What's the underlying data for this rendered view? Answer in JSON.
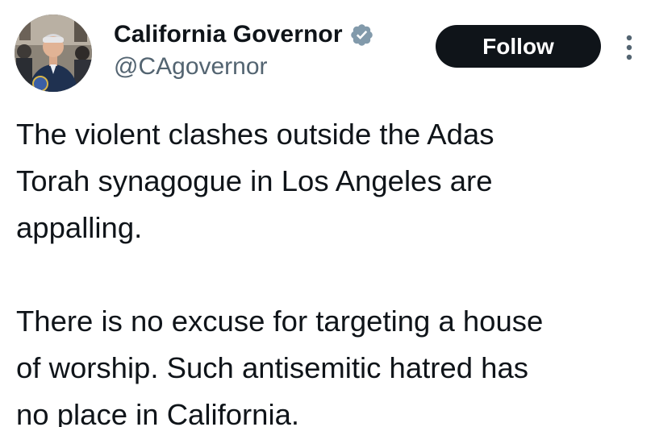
{
  "author": {
    "display_name": "California Governor",
    "handle": "@CAgovernor",
    "verified_icon": "verified-badge-icon",
    "verified_color": "#829aab",
    "avatar_icon": "profile-photo-avatar"
  },
  "actions": {
    "follow_label": "Follow",
    "more_icon": "more-options-icon"
  },
  "tweet": {
    "paragraph1_lines": [
      "The violent clashes outside the Adas",
      "Torah synagogue in Los Angeles are",
      "appalling."
    ],
    "paragraph2_lines": [
      "There is no excuse for targeting a house",
      "of worship. Such antisemitic hatred has",
      "no place in California."
    ]
  },
  "colors": {
    "text_primary": "#0f1419",
    "text_secondary": "#536471",
    "button_bg": "#0f1419",
    "button_text": "#ffffff",
    "background": "#ffffff"
  }
}
